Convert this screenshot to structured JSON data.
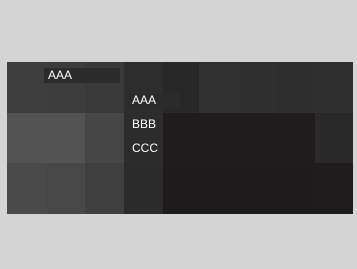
{
  "colors": {
    "background": "#d4d4d4",
    "panel": "#2d2d2d",
    "selection": "#2b2b2b",
    "text": "#ffffff"
  },
  "panel": {
    "tiles": [
      "#3e3e3e",
      "#3c3c3c",
      "#393939",
      "#2d2d2d",
      "#282828",
      "#303030",
      "#2f2f2f",
      "#2e2e2e",
      "#2f2f2f",
      "#535353",
      "#525252",
      "#464646",
      "#2c2c2c",
      "#1f1c1d",
      "#1f1c1d",
      "#1f1c1d",
      "#1f1c1d",
      "#292929",
      "#4a4a4a",
      "#474747",
      "#3f3f3f",
      "#2b2b2b",
      "#1e1b1c",
      "#1e1b1c",
      "#1e1b1c",
      "#1e1b1c",
      "#1f1c1d"
    ]
  },
  "combo": {
    "value": "AAA"
  },
  "list": {
    "items": [
      {
        "label": "AAA",
        "selected": true
      },
      {
        "label": "BBB",
        "selected": false
      },
      {
        "label": "CCC",
        "selected": false
      }
    ]
  }
}
